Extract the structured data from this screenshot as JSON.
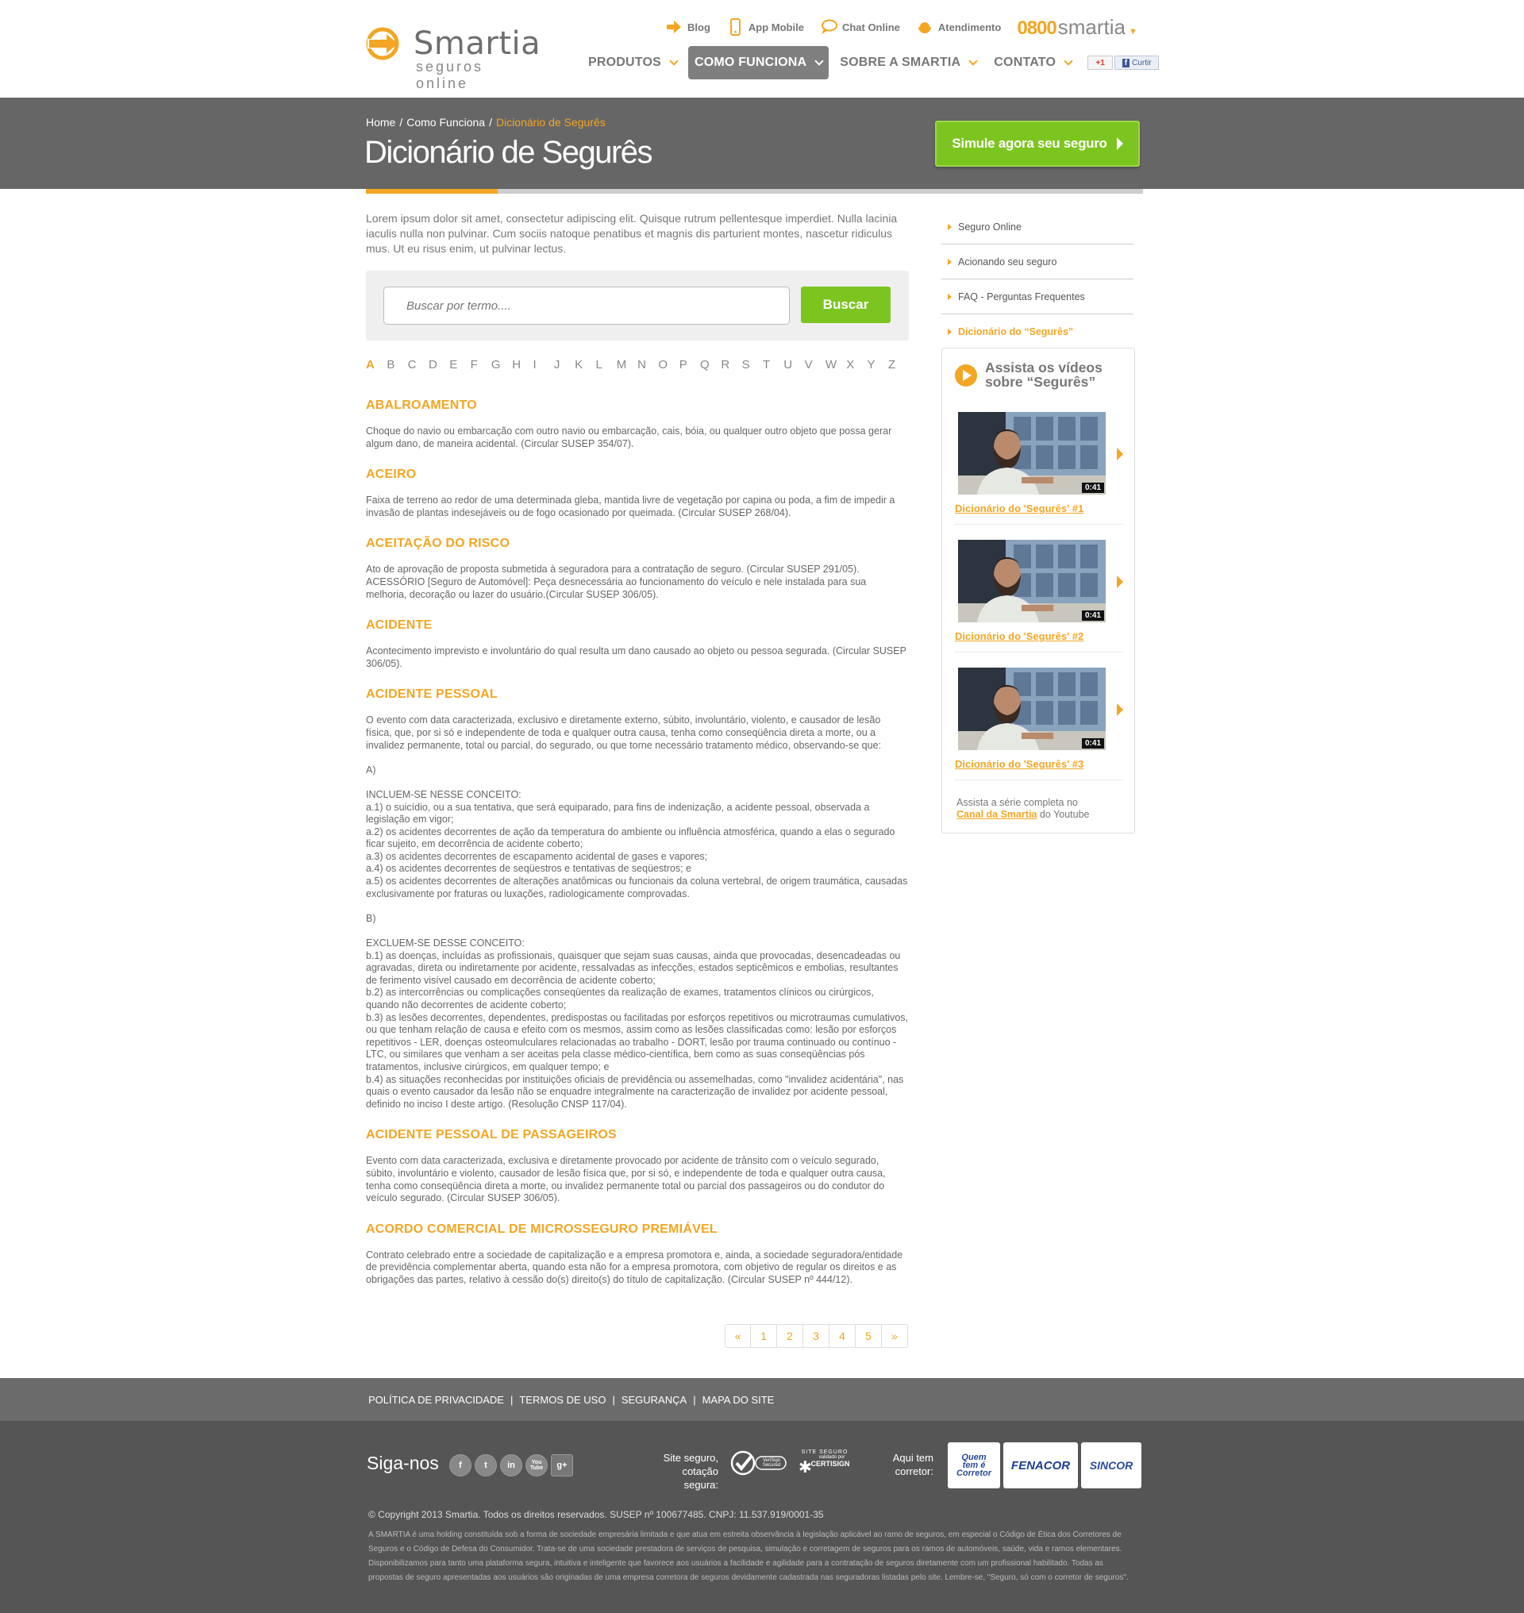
{
  "brand": {
    "name": "Smartia",
    "tagline": "seguros online"
  },
  "toplinks": [
    {
      "label": "Blog",
      "icon": "arrow-icon"
    },
    {
      "label": "App Mobile",
      "icon": "mobile-icon"
    },
    {
      "label": "Chat Online",
      "icon": "chat-icon"
    },
    {
      "label": "Atendimento",
      "icon": "headset-icon"
    }
  ],
  "phone": {
    "number": "0800",
    "brand": "smartia",
    "caret": "▼"
  },
  "nav": [
    {
      "label": "PRODUTOS",
      "active": false
    },
    {
      "label": "COMO FUNCIONA",
      "active": true
    },
    {
      "label": "SOBRE A SMARTIA",
      "active": false
    },
    {
      "label": "CONTATO",
      "active": false
    }
  ],
  "social_buttons": {
    "gplus": "+1",
    "facebook": "Curtir",
    "facebook_icon": "f"
  },
  "breadcrumb": [
    "Home",
    "/",
    "Como Funciona",
    "/",
    "Dicionário de Segurês"
  ],
  "page_title": "Dicionário de Segurês",
  "cta": "Simule agora seu seguro",
  "progress": 0.17,
  "intro": "Lorem ipsum dolor sit amet, consectetur adipiscing elit. Quisque rutrum pellentesque imperdiet. Nulla lacinia iaculis nulla non pulvinar. Cum sociis natoque penatibus et magnis dis parturient montes, nascetur ridiculus mus. Ut eu risus enim, ut pulvinar lectus.",
  "search": {
    "placeholder": "Buscar por termo....",
    "button": "Buscar"
  },
  "letters": [
    "A",
    "B",
    "C",
    "D",
    "E",
    "F",
    "G",
    "H",
    "I",
    "J",
    "K",
    "L",
    "M",
    "N",
    "O",
    "P",
    "Q",
    "R",
    "S",
    "T",
    "U",
    "V",
    "W",
    "X",
    "Y",
    "Z"
  ],
  "active_letter": "A",
  "entries": [
    {
      "term": "ABALROAMENTO",
      "text": "Choque do navio ou embarcação com outro navio ou embarcação, cais, bóia, ou qualquer outro objeto que possa gerar algum dano, de maneira acidental. (Circular SUSEP 354/07)."
    },
    {
      "term": "ACEIRO",
      "text": "Faixa de terreno ao redor de uma determinada gleba, mantida livre de vegetação por capina ou poda, a fim de impedir a invasão de plantas indesejáveis ou de fogo ocasionado por queimada. (Circular SUSEP 268/04)."
    },
    {
      "term": "ACEITAÇÃO DO RISCO",
      "text": "Ato de aprovação de proposta submetida à seguradora para a contratação de seguro. (Circular SUSEP 291/05).\nACESSÓRIO [Seguro de Automóvel]: Peça desnecessária ao funcionamento do veículo e nele instalada para sua melhoria, decoração ou lazer do usuário.(Circular SUSEP 306/05)."
    },
    {
      "term": "ACIDENTE",
      "text": "Acontecimento imprevisto e involuntário do qual resulta um dano causado ao objeto ou pessoa segurada. (Circular SUSEP 306/05)."
    },
    {
      "term": "ACIDENTE PESSOAL",
      "text": "O evento com data caracterizada, exclusivo e diretamente externo, súbito, involuntário, violento, e causador de lesão física, que, por si só e independente de toda e qualquer outra causa, tenha como conseqüência direta a morte, ou a invalidez permanente, total ou parcial, do segurado, ou que torne necessário tratamento médico, observando-se que:\n\nA)\n\nINCLUEM-SE NESSE CONCEITO:\na.1) o suicídio, ou a sua tentativa, que será equiparado, para fins de indenização, a acidente pessoal, observada a legislação em vigor;\na.2) os acidentes decorrentes de ação da temperatura do ambiente ou influência atmosférica, quando a elas o segurado ficar sujeito, em decorrência de acidente coberto;\na.3) os acidentes decorrentes de escapamento acidental de gases e vapores;\na.4) os acidentes decorrentes de seqüestros e tentativas de seqüestros; e\na.5) os acidentes decorrentes de alterações anatômicas ou funcionais da coluna vertebral, de origem traumática, causadas exclusivamente por fraturas ou luxações, radiologicamente comprovadas.\n\nB)\n\nEXCLUEM-SE DESSE CONCEITO:\nb.1) as doenças, incluídas as profissionais, quaisquer que sejam suas causas, ainda que provocadas, desencadeadas ou agravadas, direta ou indiretamente por acidente, ressalvadas as infecções, estados septicêmicos e embolias, resultantes de ferimento visível causado em decorrência de acidente coberto;\nb.2) as intercorrências ou complicações conseqüentes da realização de exames, tratamentos clínicos ou cirúrgicos, quando não decorrentes de acidente coberto;\nb.3) as lesões decorrentes, dependentes, predispostas ou facilitadas por esforços repetitivos ou microtraumas cumulativos, ou que tenham relação de causa e efeito com os mesmos, assim como as lesões classificadas como: lesão por esforços repetitivos - LER, doenças osteomulculares relacionadas ao trabalho - DORT, lesão por trauma continuado ou contínuo - LTC, ou similares que venham a ser aceitas pela classe médico-científica, bem como as suas conseqüências pós tratamentos, inclusive cirúrgicos, em qualquer tempo; e\nb.4) as situações reconhecidas por instituições oficiais de previdência ou assemelhadas, como \"invalidez acidentária\", nas quais o evento causador da lesão não se enquadre integralmente na caracterização de invalidez por acidente pessoal, definido no inciso I deste artigo. (Resolução CNSP 117/04)."
    },
    {
      "term": "ACIDENTE PESSOAL DE PASSAGEIROS",
      "text": "Evento com data caracterizada, exclusiva e diretamente provocado por acidente de trânsito com o veículo segurado, súbito, involuntário e violento, causador de lesão física que, por si só, e independente de toda e qualquer outra causa, tenha como conseqüência direta a morte, ou invalidez permanente total ou parcial dos passageiros ou do condutor do veículo segurado. (Circular SUSEP 306/05)."
    },
    {
      "term": "ACORDO COMERCIAL DE MICROSSEGURO PREMIÁVEL",
      "text": "Contrato celebrado entre a sociedade de capitalização e a empresa promotora e, ainda, a sociedade seguradora/entidade de previdência complementar aberta, quando esta não for a empresa promotora, com objetivo de regular os direitos e as obrigações das partes, relativo à cessão do(s) direito(s) do título de capitalização. (Circular SUSEP nº 444/12)."
    }
  ],
  "pager": [
    "«",
    "1",
    "2",
    "3",
    "4",
    "5",
    "»"
  ],
  "sidebar": {
    "links": [
      {
        "label": "Seguro Online",
        "active": false
      },
      {
        "label": "Acionando seu seguro",
        "active": false
      },
      {
        "label": "FAQ - Perguntas Frequentes",
        "active": false
      },
      {
        "label": "Dicionário do “Segurês”",
        "active": true
      }
    ],
    "videos_title_1": "Assista os vídeos",
    "videos_title_2": "sobre “Segurês”",
    "videos": [
      {
        "title": "Dicionário do 'Segurês' #1",
        "duration": "0:41"
      },
      {
        "title": "Dicionário do 'Segurês' #2",
        "duration": "0:41"
      },
      {
        "title": "Dicionário do 'Segurês' #3",
        "duration": "0:41"
      }
    ],
    "footer_text": "Assista a série completa no",
    "footer_link": "Canal da Smartia",
    "footer_suffix": "do Youtube"
  },
  "footer": {
    "links": [
      "POLÍTICA DE PRIVACIDADE",
      "TERMOS DE USO",
      "SEGURANÇA",
      "MAPA DO SITE"
    ],
    "separator": "|",
    "follow": "Siga-nos",
    "social_icons": [
      "f",
      "t",
      "in",
      "You Tube",
      "g+"
    ],
    "site_seguro_1": "Site seguro,",
    "site_seguro_2": "cotação segura:",
    "seal_verisign": "VeriSign Secured",
    "seal_certisign_1": "SITE SEGURO",
    "seal_certisign_2": "validado por",
    "seal_certisign_3": "CERTISIGN",
    "broker_1": "Aqui tem",
    "broker_2": "corretor:",
    "badges": [
      "Quem tem é Corretor",
      "FENACOR",
      "SINCOR"
    ],
    "copyright": "© Copyright 2013 Smartia. Todos os direitos reservados. SUSEP nº 100677485. CNPJ: 11.537.919/0001-35",
    "legal": "A SMARTIA é uma holding constituída sob a forma de sociedade empresária limitada e que atua em estreita observância à legislação aplicável ao ramo de seguros, em especial o Código de Ética dos Corretores de Seguros e o Código de Defesa do Consumidor. Trata-se de uma sociedade prestadora de serviços de pesquisa, simulação e corretagem de seguros para os ramos de automóveis, saúde, vida e ramos elementares. Disponibilizamos para tanto uma plataforma segura, intuitiva e inteligente que favorece aos usuários a facilidade e agilidade para a contratação de seguros diretamente com um profissional habilitado. Todas as propostas de seguro apresentadas aos usuários são originadas de uma empresa corretora de seguros devidamente cadastrada nas seguradoras listadas pelo site. Lembre-se, \"Seguro, só com o corretor de seguros\"."
  },
  "colors": {
    "accent": "#f3a623",
    "green": "#7cc520",
    "band": "#666666",
    "footer": "#555555"
  }
}
